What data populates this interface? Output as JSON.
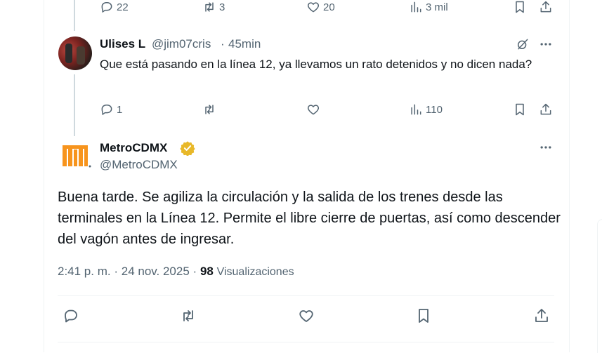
{
  "top_actions": {
    "replies": "22",
    "retweets": "3",
    "likes": "20",
    "views": "3 mil"
  },
  "reply": {
    "name": "Ulises L",
    "handle": "@jim07cris",
    "separator": "·",
    "time": "45min",
    "text": "Que está pasando en la línea 12, ya llevamos un rato detenidos y no dicen nada?",
    "replies": "1",
    "retweets": "",
    "likes": "",
    "views": "110"
  },
  "main_tweet": {
    "name": "MetroCDMX",
    "handle": "@MetroCDMX",
    "text": "Buena tarde. Se agiliza la circulación y la salida de los trenes desde las terminales en la Línea 12. Permite el libre cierre de puertas, así como descender del vagón antes de ingresar.",
    "time": "2:41 p. m.",
    "sep1": "·",
    "date": "24 nov. 2025",
    "sep2": "·",
    "views_count": "98",
    "views_label": "Visualizaciones"
  },
  "colors": {
    "text": "#0f1419",
    "secondary": "#536471",
    "border": "#eff3f4",
    "metro_orange": "#f7941d",
    "verified_gold": "#e8b829"
  },
  "icons": [
    "reply-icon",
    "retweet-icon",
    "like-icon",
    "views-icon",
    "bookmark-icon",
    "share-icon",
    "grok-icon",
    "more-icon",
    "verified-badge-icon",
    "metro-logo-icon"
  ]
}
